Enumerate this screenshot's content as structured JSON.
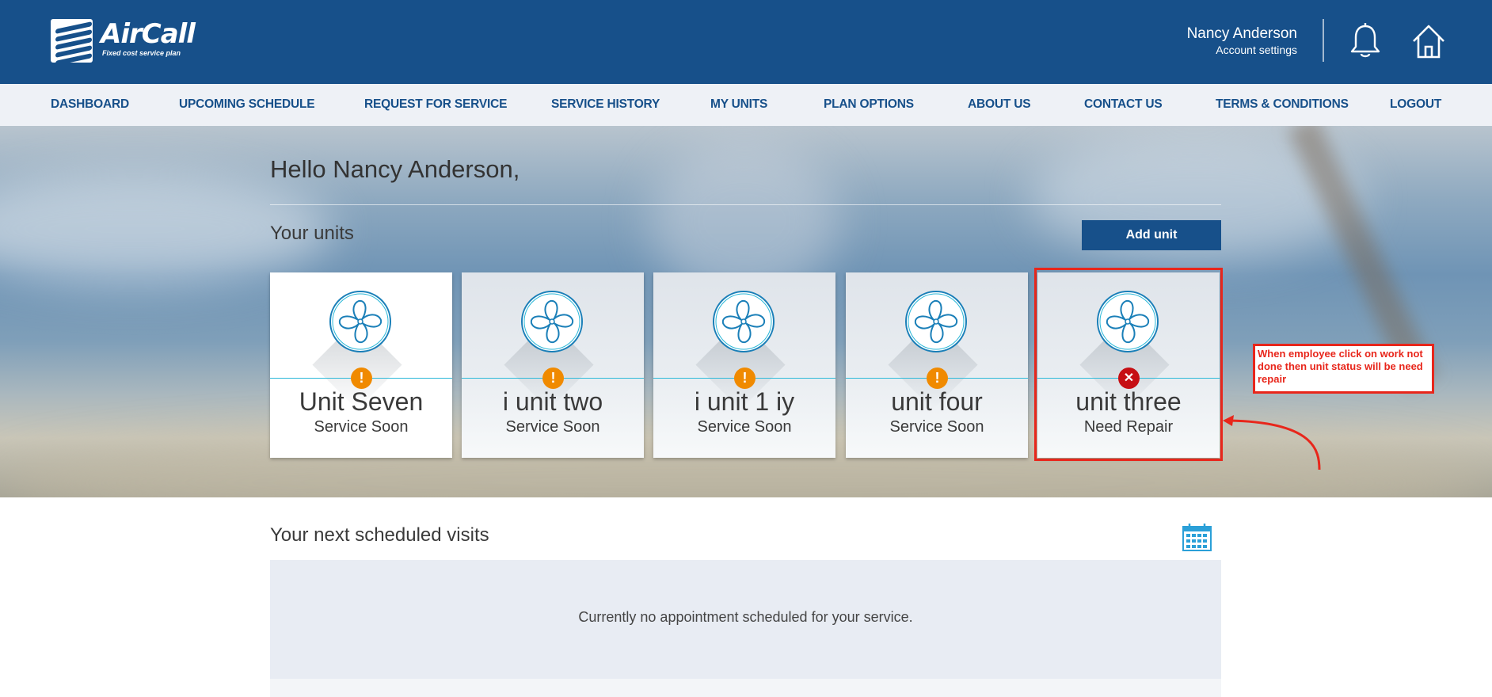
{
  "brand": {
    "name": "AirCall",
    "tagline": "Fixed cost service plan"
  },
  "user": {
    "name": "Nancy Anderson",
    "account_link": "Account settings"
  },
  "header_icons": {
    "notifications": "bell-icon",
    "home": "home-icon"
  },
  "nav": [
    {
      "label": "DASHBOARD"
    },
    {
      "label": "UPCOMING SCHEDULE"
    },
    {
      "label": "REQUEST FOR SERVICE"
    },
    {
      "label": "SERVICE HISTORY"
    },
    {
      "label": "MY UNITS"
    },
    {
      "label": "PLAN OPTIONS"
    },
    {
      "label": "ABOUT US"
    },
    {
      "label": "CONTACT US"
    },
    {
      "label": "TERMS & CONDITIONS"
    },
    {
      "label": "LOGOUT"
    }
  ],
  "greeting": "Hello Nancy Anderson,",
  "units_section": {
    "title": "Your units",
    "add_button": "Add unit",
    "units": [
      {
        "name": "Unit Seven",
        "status": "Service Soon",
        "status_type": "warning",
        "status_symbol": "!"
      },
      {
        "name": "i unit two",
        "status": "Service Soon",
        "status_type": "warning",
        "status_symbol": "!"
      },
      {
        "name": "i unit 1 iy",
        "status": "Service Soon",
        "status_type": "warning",
        "status_symbol": "!"
      },
      {
        "name": "unit four",
        "status": "Service Soon",
        "status_type": "warning",
        "status_symbol": "!"
      },
      {
        "name": "unit three",
        "status": "Need Repair",
        "status_type": "error",
        "status_symbol": "✕"
      }
    ]
  },
  "annotation": {
    "text": "When employee click on work not done then unit status will be need repair",
    "color": "#e8261b"
  },
  "visits": {
    "title": "Your next scheduled visits",
    "empty_message": "Currently no appointment scheduled for your service.",
    "calendar_icon": "calendar-icon"
  },
  "colors": {
    "brand_blue": "#17508a",
    "accent_cyan": "#2bb8d8",
    "warning": "#f08a00",
    "error": "#c60f14"
  }
}
